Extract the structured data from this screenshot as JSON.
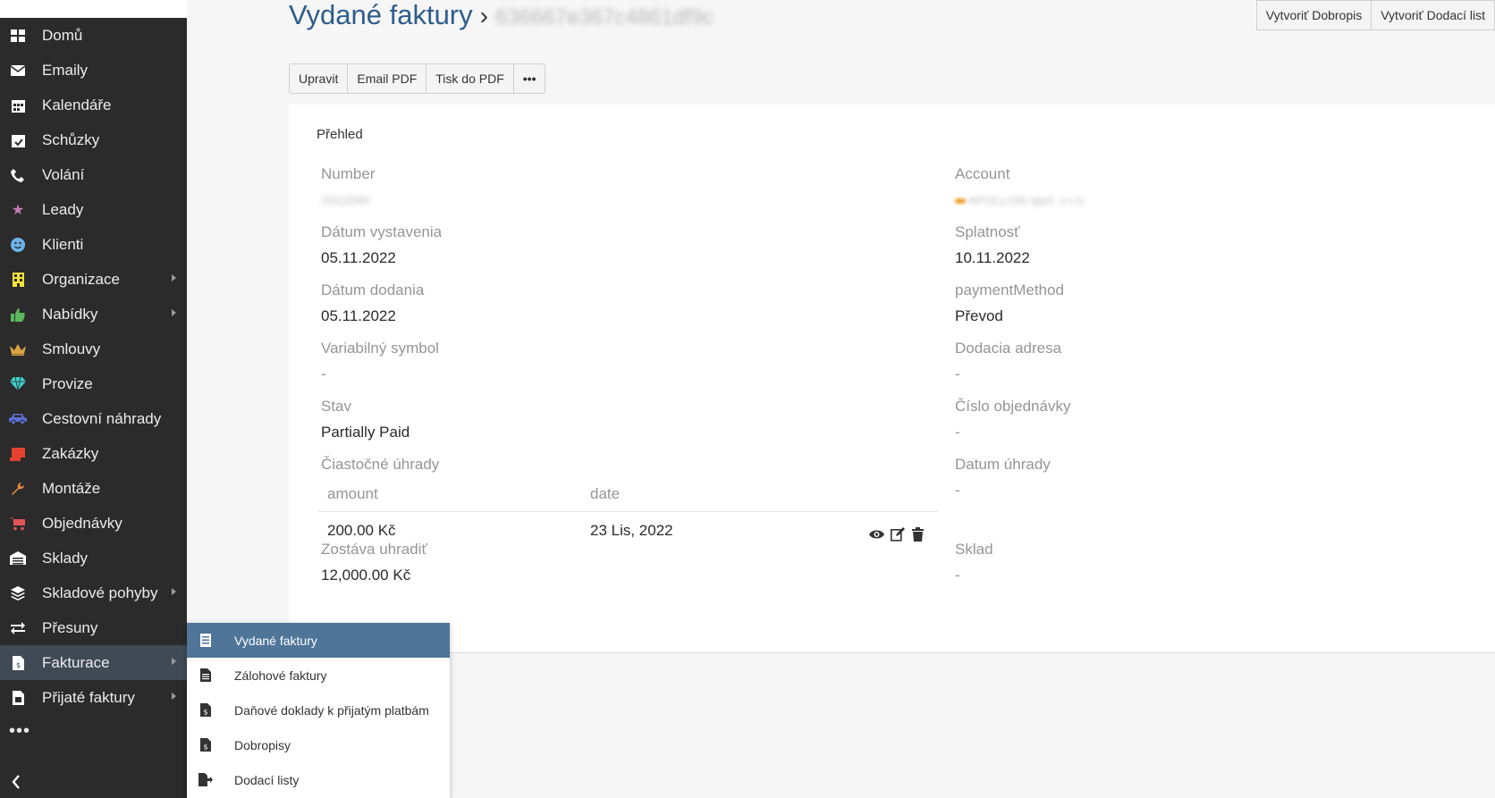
{
  "sidebar": {
    "items": [
      {
        "label": "Domů",
        "icon": "dashboard-icon",
        "color": "#ffffff"
      },
      {
        "label": "Emaily",
        "icon": "envelope-icon",
        "color": "#ffffff"
      },
      {
        "label": "Kalendáře",
        "icon": "calendar-icon",
        "color": "#ffffff"
      },
      {
        "label": "Schůzky",
        "icon": "calendar-check-icon",
        "color": "#ffffff"
      },
      {
        "label": "Volání",
        "icon": "phone-icon",
        "color": "#ffffff"
      },
      {
        "label": "Leady",
        "icon": "star-icon",
        "color": "#c77dbb"
      },
      {
        "label": "Klienti",
        "icon": "smile-icon",
        "color": "#6cb4e8"
      },
      {
        "label": "Organizace",
        "icon": "building-icon",
        "color": "#f5e33a",
        "submenu": true
      },
      {
        "label": "Nabídky",
        "icon": "thumbs-up-icon",
        "color": "#5cb85c",
        "submenu": true
      },
      {
        "label": "Smlouvy",
        "icon": "crown-icon",
        "color": "#d9a441"
      },
      {
        "label": "Provize",
        "icon": "diamond-icon",
        "color": "#3dd0c8"
      },
      {
        "label": "Cestovní náhrady",
        "icon": "car-icon",
        "color": "#5c6fd6"
      },
      {
        "label": "Zakázky",
        "icon": "clipboard-icon",
        "color": "#e3432e"
      },
      {
        "label": "Montáže",
        "icon": "wrench-icon",
        "color": "#e8913a"
      },
      {
        "label": "Objednávky",
        "icon": "cart-icon",
        "color": "#e35555"
      },
      {
        "label": "Sklady",
        "icon": "warehouse-icon",
        "color": "#ffffff"
      },
      {
        "label": "Skladové pohyby",
        "icon": "layers-icon",
        "color": "#ffffff",
        "submenu": true
      },
      {
        "label": "Přesuny",
        "icon": "transfer-icon",
        "color": "#ffffff"
      },
      {
        "label": "Fakturace",
        "icon": "invoice-icon",
        "color": "#ffffff",
        "submenu": true,
        "active": true
      },
      {
        "label": "Přijaté faktury",
        "icon": "received-invoice-icon",
        "color": "#ffffff",
        "submenu": true
      }
    ],
    "more_label": "•••"
  },
  "header": {
    "title": "Vydané faktury",
    "separator": "›",
    "record_id": "636667e367c4861df9c",
    "buttons": [
      "Vytvoriť Dobropis",
      "Vytvoriť Dodací list"
    ]
  },
  "actions": {
    "edit": "Upravit",
    "email_pdf": "Email PDF",
    "print_pdf": "Tisk do PDF",
    "more": "•••"
  },
  "panel": {
    "heading": "Přehled",
    "fields": {
      "number_label": "Number",
      "number_value": "2022090",
      "account_label": "Account",
      "account_value": "APOLLON spol. s r.o.",
      "issue_date_label": "Dátum vystavenia",
      "issue_date_value": "05.11.2022",
      "due_label": "Splatnosť",
      "due_value": "10.11.2022",
      "delivery_date_label": "Dátum dodania",
      "delivery_date_value": "05.11.2022",
      "payment_method_label": "paymentMethod",
      "payment_method_value": "Převod",
      "var_symbol_label": "Variabilný symbol",
      "var_symbol_value": "-",
      "delivery_address_label": "Dodacia adresa",
      "delivery_address_value": "-",
      "status_label": "Stav",
      "status_value": "Partially Paid",
      "order_number_label": "Číslo objednávky",
      "order_number_value": "-",
      "partial_payments_label": "Čiastočné úhrady",
      "payment_date_label": "Datum úhrady",
      "payment_date_value": "-",
      "remaining_label": "Zostáva uhradiť",
      "remaining_value": "12,000.00 Kč",
      "warehouse_label": "Sklad",
      "warehouse_value": "-"
    },
    "payments_table": {
      "columns": [
        "amount",
        "date"
      ],
      "rows": [
        {
          "amount": "200.00 Kč",
          "date": "23 Lis, 2022"
        }
      ]
    }
  },
  "submenu": {
    "items": [
      {
        "label": "Vydané faktury",
        "icon": "invoice-list-icon",
        "active": true
      },
      {
        "label": "Zálohové faktury",
        "icon": "document-icon"
      },
      {
        "label": "Daňové doklady k přijatým platbám",
        "icon": "tax-document-icon"
      },
      {
        "label": "Dobropisy",
        "icon": "credit-note-icon"
      },
      {
        "label": "Dodací listy",
        "icon": "delivery-note-icon"
      }
    ]
  }
}
